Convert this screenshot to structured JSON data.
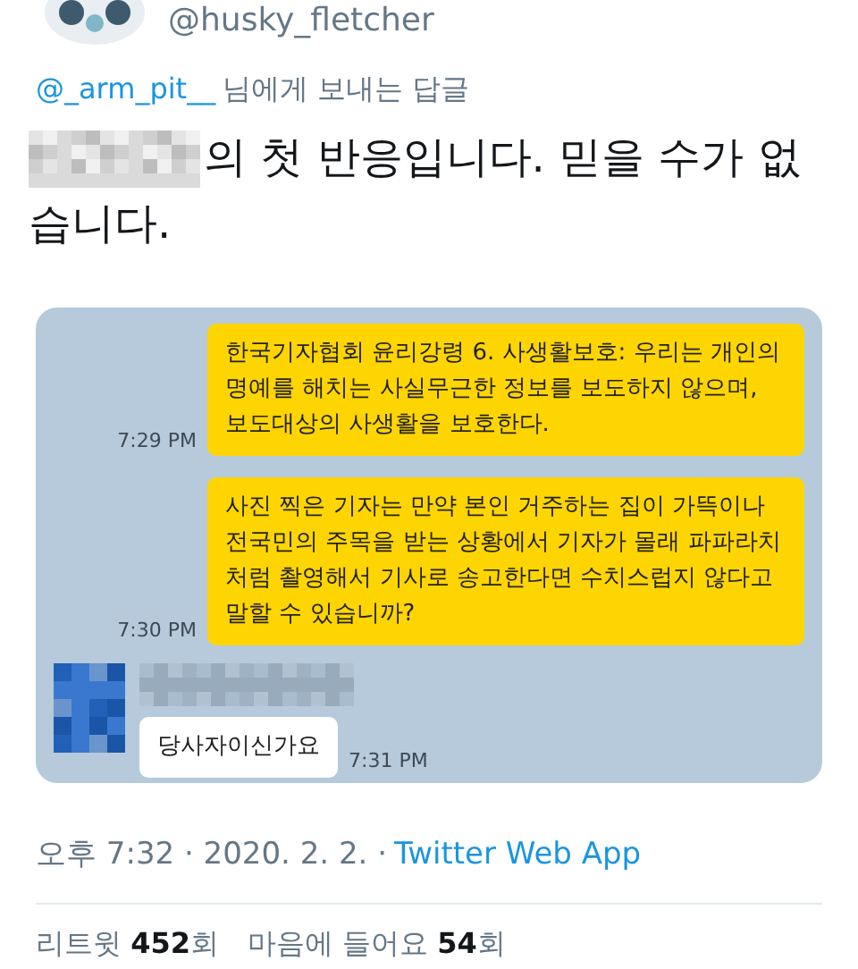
{
  "tweet": {
    "handle": "@husky_fletcher",
    "reply_to": {
      "mention": "@_arm_pit__",
      "text": "님에게 보내는 답글"
    },
    "text": "의 첫 반응입니다. 믿을 수가 없습니다.",
    "chat": {
      "messages": [
        {
          "kind": "sent",
          "text": "한국기자협회 윤리강령 6. 사생활보호: 우리는 개인의 명예를 해치는 사실무근한 정보를 보도하지 않으며, 보도대상의 사생활을 보호한다.",
          "time": "7:29 PM"
        },
        {
          "kind": "sent",
          "text": "사진 찍은 기자는 만약 본인 거주하는 집이 가뜩이나 전국민의 주목을 받는 상황에서 기자가 몰래 파파라치처럼 촬영해서 기사로 송고한다면 수치스럽지 않다고 말할 수 있습니까?",
          "time": "7:30 PM"
        },
        {
          "kind": "received",
          "text": "당사자이신가요",
          "time": "7:31 PM"
        }
      ]
    },
    "meta": {
      "time": "오후 7:32 · 2020. 2. 2. ·",
      "source": "Twitter Web App"
    },
    "stats": [
      "리트윗 **452**회",
      "마음에 들어요 **54**회"
    ]
  }
}
